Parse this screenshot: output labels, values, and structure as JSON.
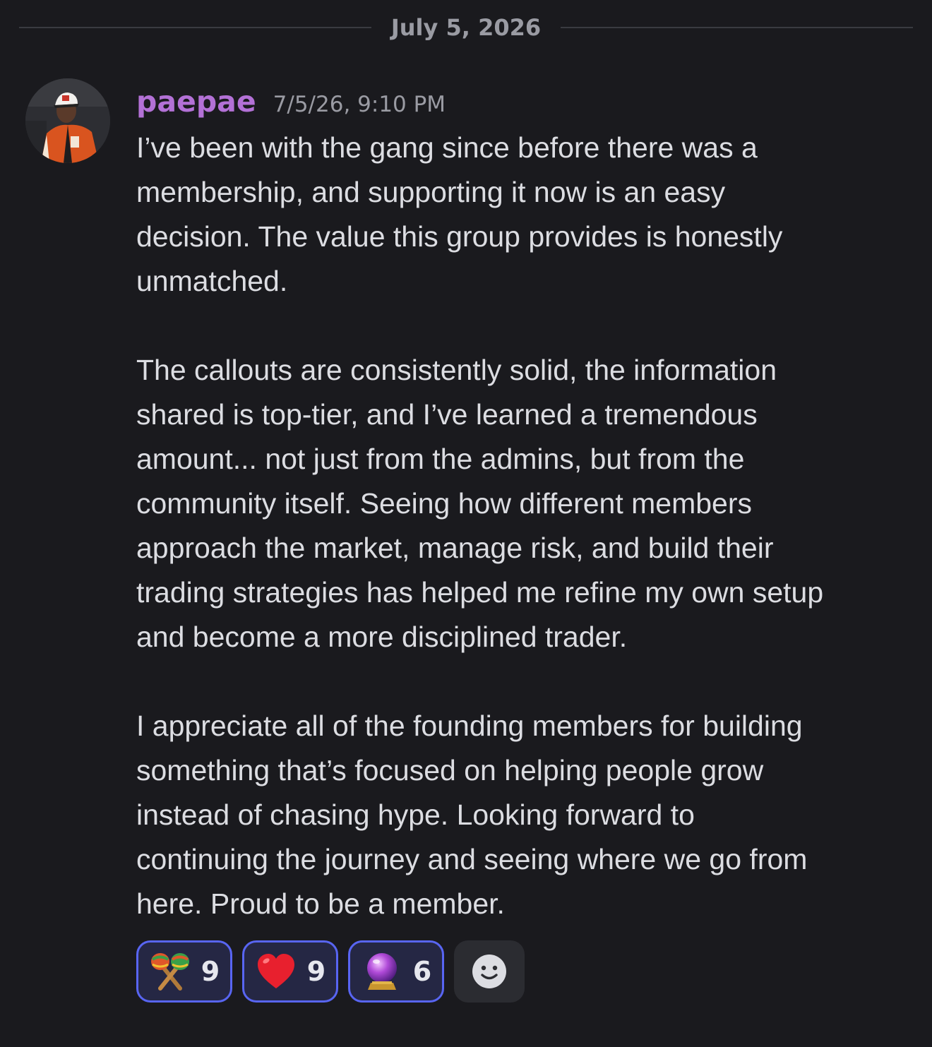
{
  "divider": {
    "date": "July 5, 2026"
  },
  "message": {
    "author": "paepae",
    "timestamp": "7/5/26, 9:10 PM",
    "author_color": "#b371d6",
    "lines": [
      "I’ve been with the gang since before there was a",
      "membership, and supporting it now is an easy",
      "decision. The value this group provides is honestly",
      "unmatched.",
      "",
      "The callouts are consistently solid, the information",
      "shared is top-tier, and I’ve learned a tremendous",
      "amount... not just from the admins, but from the",
      "community itself. Seeing how different members",
      "approach the market, manage risk, and build their",
      "trading strategies has helped me refine my own setup",
      "and become a more disciplined trader.",
      "",
      "I appreciate all of the founding members for building",
      "something that’s focused on helping people grow",
      "instead of chasing hype. Looking forward to",
      "continuing the journey and seeing where we go from",
      "here. Proud to be a member."
    ]
  },
  "reactions": [
    {
      "icon": "maracas-emoji",
      "count": "9"
    },
    {
      "icon": "red-heart-emoji",
      "count": "9"
    },
    {
      "icon": "crystal-ball-emoji",
      "count": "6"
    }
  ],
  "add_reaction": {
    "icon": "smiley-face-icon"
  },
  "colors": {
    "background": "#1a1a1e",
    "reaction_border": "#5865f2",
    "reaction_bg": "#252744",
    "text": "#dcdde2",
    "muted": "#9a9ba3"
  }
}
